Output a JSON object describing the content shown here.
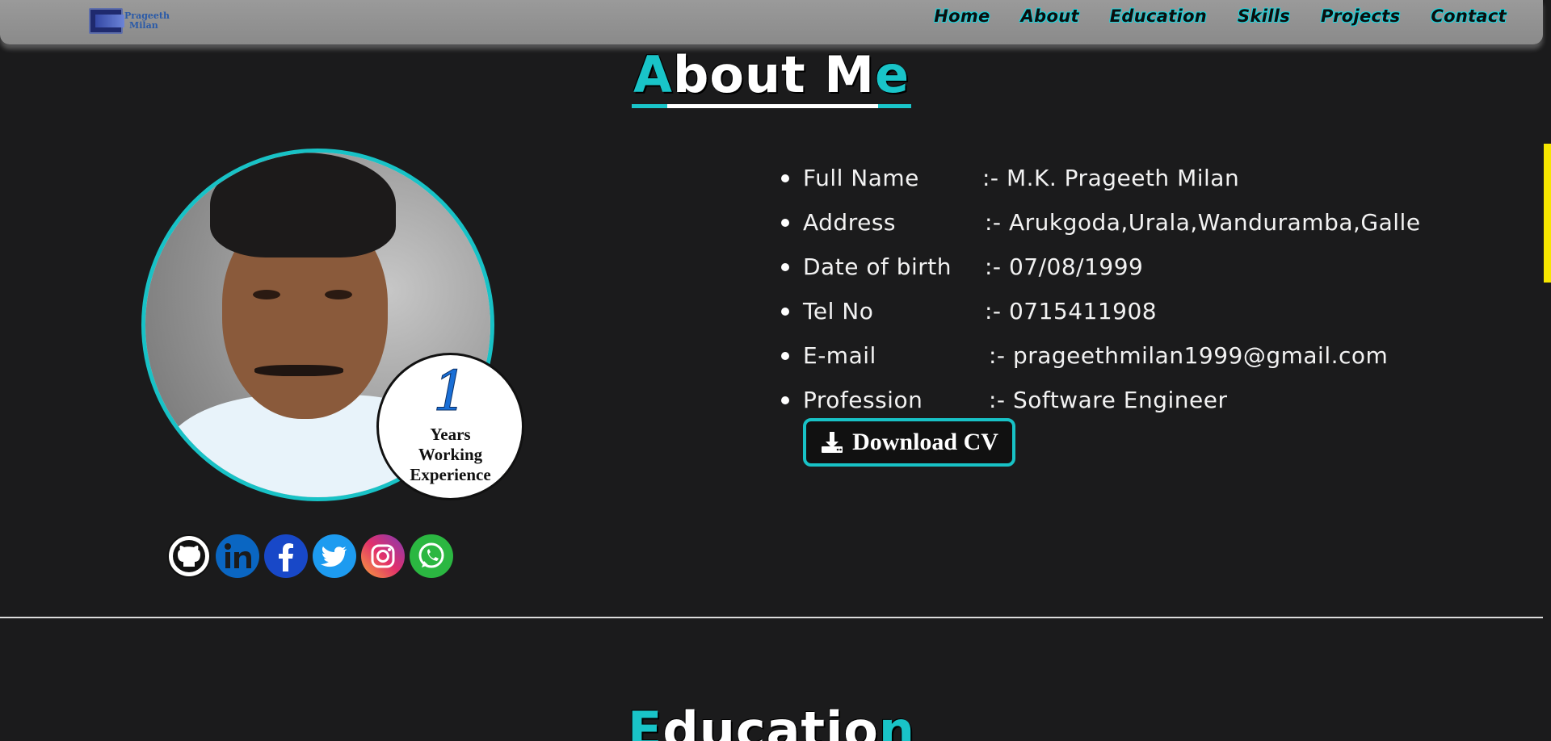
{
  "header": {
    "logo_line1": "Prageeth",
    "logo_line2": "Milan",
    "nav": [
      "Home",
      "About",
      "Education",
      "Skills",
      "Projects",
      "Contact"
    ]
  },
  "about": {
    "title_first": "A",
    "title_mid": "bout M",
    "title_last": "e",
    "experience_number": "1",
    "experience_line1": "Years",
    "experience_line2": "Working",
    "experience_line3": "Experience",
    "info": [
      {
        "key": "Full Name",
        "value": ":- M.K. Prageeth Milan"
      },
      {
        "key": "Address",
        "value": ":- Arukgoda,Urala,Wanduramba,Galle"
      },
      {
        "key": "Date of birth",
        "value": ":- 07/08/1999"
      },
      {
        "key": "Tel No",
        "value": ":- 0715411908"
      },
      {
        "key": "E-mail",
        "value": ":- prageethmilan1999@gmail.com"
      },
      {
        "key": "Profession",
        "value": ":- Software Engineer"
      }
    ],
    "download_label": "Download CV",
    "socials": [
      "github-icon",
      "linkedin-icon",
      "facebook-icon",
      "twitter-icon",
      "instagram-icon",
      "whatsapp-icon"
    ]
  },
  "education": {
    "title_first": "E",
    "title_mid": "ducatio",
    "title_last": "n"
  },
  "colors": {
    "accent": "#19c4c8",
    "background": "#1b1b1c",
    "scroll_marker": "#f6e600"
  }
}
